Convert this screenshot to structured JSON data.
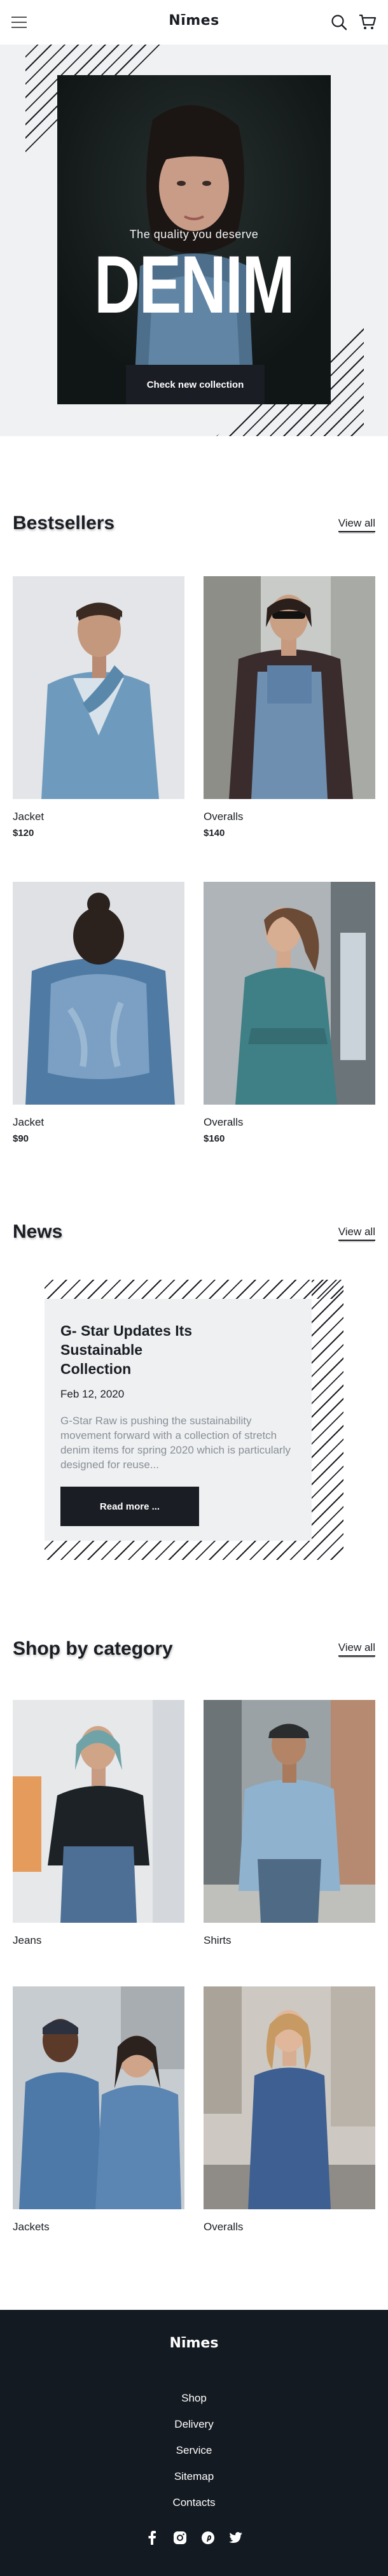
{
  "header": {
    "logo": "Nīmes",
    "menu_icon": "hamburger-icon",
    "search_icon": "search-icon",
    "cart_icon": "cart-icon"
  },
  "hero": {
    "tagline": "The quality you deserve",
    "title": "DENIM",
    "button": "Check new collection"
  },
  "bestsellers": {
    "title": "Bestsellers",
    "view_all": "View all",
    "products": [
      {
        "name": "Jacket",
        "price": "$120"
      },
      {
        "name": "Overalls",
        "price": "$140"
      },
      {
        "name": "Jacket",
        "price": "$90"
      },
      {
        "name": "Overalls",
        "price": "$160"
      }
    ]
  },
  "news": {
    "title": "News",
    "view_all": "View all",
    "article": {
      "title": "G- Star Updates Its Sustainable Collection",
      "date": "Feb 12, 2020",
      "excerpt": "G-Star Raw is pushing the sustainability movement forward with a collection of stretch denim items for spring 2020 which is particularly designed for reuse...",
      "button": "Read more ..."
    }
  },
  "categories": {
    "title": "Shop by category",
    "view_all": "View all",
    "items": [
      {
        "name": "Jeans"
      },
      {
        "name": "Shirts"
      },
      {
        "name": "Jackets"
      },
      {
        "name": "Overalls"
      }
    ]
  },
  "footer": {
    "logo": "Nīmes",
    "links": [
      "Shop",
      "Delivery",
      "Service",
      "Sitemap",
      "Contacts"
    ],
    "socials": [
      "facebook-icon",
      "instagram-icon",
      "pinterest-icon",
      "twitter-icon"
    ]
  },
  "colors": {
    "dark": "#1a1d23",
    "footer_bg": "#141a21",
    "hero_bg": "#f0f1f3",
    "muted_text": "#8a8f96"
  }
}
